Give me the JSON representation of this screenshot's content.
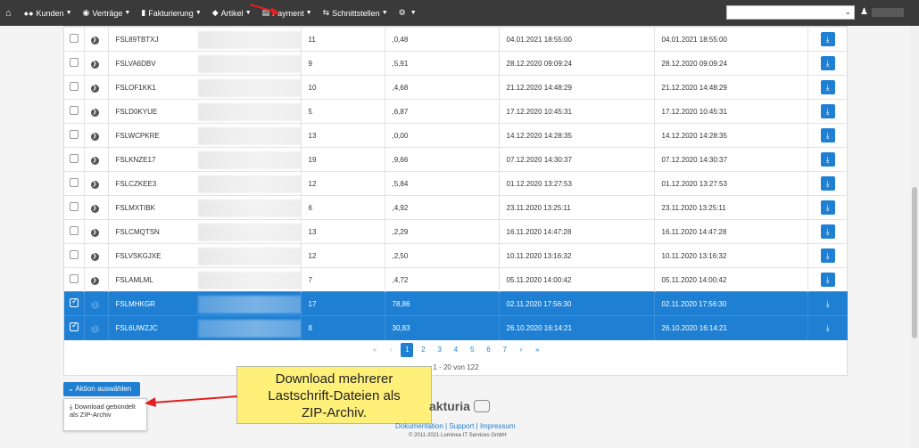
{
  "nav": {
    "home_icon": "home-icon",
    "items": [
      {
        "label": "Kunden",
        "icon": "users-icon"
      },
      {
        "label": "Verträge",
        "icon": "eye-icon"
      },
      {
        "label": "Fakturierung",
        "icon": "book-icon"
      },
      {
        "label": "Artikel",
        "icon": "tag-icon"
      },
      {
        "label": "Payment",
        "icon": "card-icon"
      },
      {
        "label": "Schnittstellen",
        "icon": "exchange-icon"
      },
      {
        "label": "",
        "icon": "gear-icon"
      }
    ],
    "select_value": "",
    "user_icon": "user-icon"
  },
  "table": {
    "rows": [
      {
        "id": "FSL89TBTXJ",
        "count": "11",
        "amount": ",0,48",
        "date1": "04.01.2021 18:55:00",
        "date2": "04.01.2021 18:55:00",
        "selected": false
      },
      {
        "id": "FSLVA6DBV",
        "count": "9",
        "amount": ",5,91",
        "date1": "28.12.2020 09:09:24",
        "date2": "28.12.2020 09:09:24",
        "selected": false
      },
      {
        "id": "FSLOF1KK1",
        "count": "10",
        "amount": ",4,68",
        "date1": "21.12.2020 14:48:29",
        "date2": "21.12.2020 14:48:29",
        "selected": false
      },
      {
        "id": "FSLD0KYUE",
        "count": "5",
        "amount": ",6,87",
        "date1": "17.12.2020 10:45:31",
        "date2": "17.12.2020 10:45:31",
        "selected": false
      },
      {
        "id": "FSLWCPKRE",
        "count": "13",
        "amount": ",0,00",
        "date1": "14.12.2020 14:28:35",
        "date2": "14.12.2020 14:28:35",
        "selected": false
      },
      {
        "id": "FSLKNZE17",
        "count": "19",
        "amount": ",9,66",
        "date1": "07.12.2020 14:30:37",
        "date2": "07.12.2020 14:30:37",
        "selected": false
      },
      {
        "id": "FSLCZKEE3",
        "count": "12",
        "amount": ",5,84",
        "date1": "01.12.2020 13:27:53",
        "date2": "01.12.2020 13:27:53",
        "selected": false
      },
      {
        "id": "FSLMXTIBK",
        "count": "6",
        "amount": ",4,92",
        "date1": "23.11.2020 13:25:11",
        "date2": "23.11.2020 13:25:11",
        "selected": false
      },
      {
        "id": "FSLCMQTSN",
        "count": "13",
        "amount": ",2,29",
        "date1": "16.11.2020 14:47:28",
        "date2": "16.11.2020 14:47:28",
        "selected": false
      },
      {
        "id": "FSLVSKGJXE",
        "count": "12",
        "amount": ",2,50",
        "date1": "10.11.2020 13:16:32",
        "date2": "10.11.2020 13:16:32",
        "selected": false
      },
      {
        "id": "FSLAMLML",
        "count": "7",
        "amount": ",4,72",
        "date1": "05.11.2020 14:00:42",
        "date2": "05.11.2020 14:00:42",
        "selected": false
      },
      {
        "id": "FSLMHKGR",
        "count": "17",
        "amount": "78,86",
        "date1": "02.11.2020 17:56:30",
        "date2": "02.11.2020 17:56:30",
        "selected": true
      },
      {
        "id": "FSL6UWZJC",
        "count": "8",
        "amount": "30,83",
        "date1": "26.10.2020 16:14:21",
        "date2": "26.10.2020 16:14:21",
        "selected": true
      }
    ]
  },
  "pager": {
    "first": "«",
    "prev": "‹",
    "pages": [
      "1",
      "2",
      "3",
      "4",
      "5",
      "6",
      "7"
    ],
    "active_page": "1",
    "next": "›",
    "last": "»",
    "info": "1 - 20 von 122"
  },
  "action": {
    "button_label": "Aktion auswählen",
    "menu_item": "Download gebündelt als ZIP-Archiv"
  },
  "callout": {
    "line1": "Download mehrerer",
    "line2": "Lastschrift-Dateien als",
    "line3": "ZIP-Archiv."
  },
  "footer": {
    "logo_text": "akturia",
    "link_docs": "Dokumentation",
    "link_support": "Support",
    "link_impressum": "Impressum",
    "sep": "|",
    "copyright": "© 2011-2021 Luminea IT Services GmbH"
  },
  "colors": {
    "accent": "#1e7fd3",
    "navbar": "#3a3a3a",
    "callout": "#fff07a",
    "annotation": "#e02020"
  }
}
